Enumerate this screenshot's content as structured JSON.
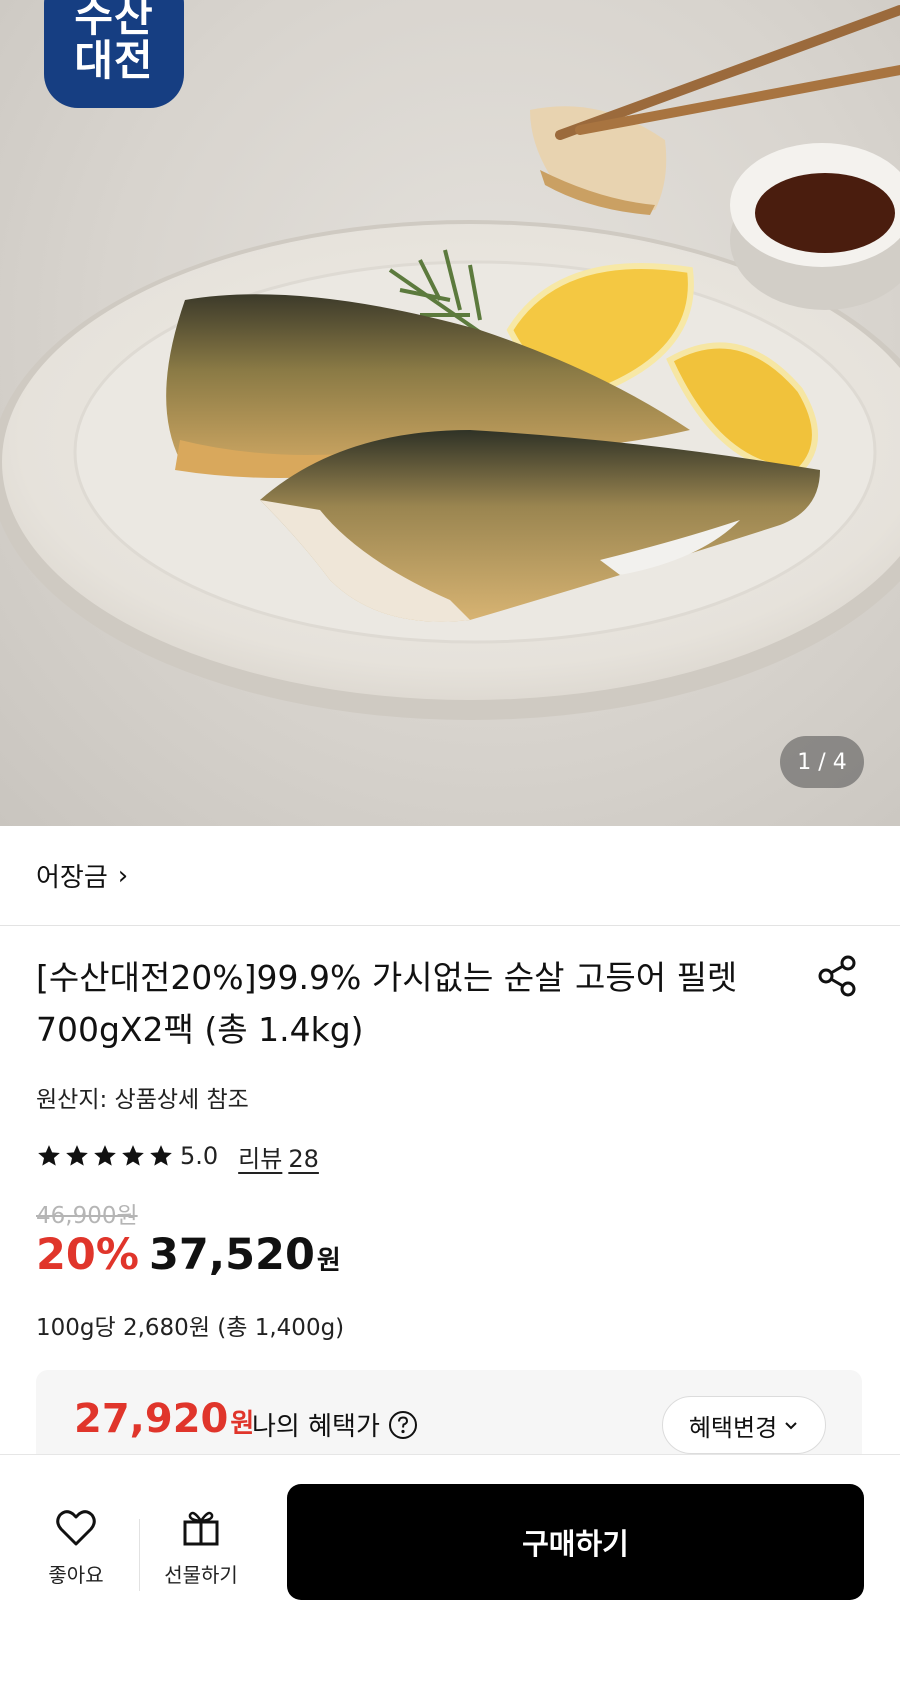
{
  "hero": {
    "brand_badge": {
      "line1": "수산",
      "line2": "대전",
      "color": "#163e82"
    },
    "image_counter": "1 / 4"
  },
  "store": {
    "name": "어장금",
    "chevron": "›"
  },
  "product": {
    "title": "[수산대전20%]99.9% 가시없는 순살 고등어 필렛 700gX2팩 (총 1.4kg)",
    "origin": "원산지: 상품상세 참조",
    "rating": {
      "score": "5.0",
      "stars": 5,
      "reviews_label": "리뷰",
      "reviews_count": "28"
    },
    "original_price": "46,900원",
    "discount": "20%",
    "price": "37,520",
    "price_unit": "원",
    "unit_price": "100g당 2,680원 (총 1,400g)",
    "accent_color": "#e0352b"
  },
  "benefit": {
    "price": "27,920",
    "price_unit": "원",
    "label": "나의 혜택가",
    "change_button": "혜택변경"
  },
  "bottom_bar": {
    "like_label": "좋아요",
    "gift_label": "선물하기",
    "buy_label": "구매하기"
  }
}
